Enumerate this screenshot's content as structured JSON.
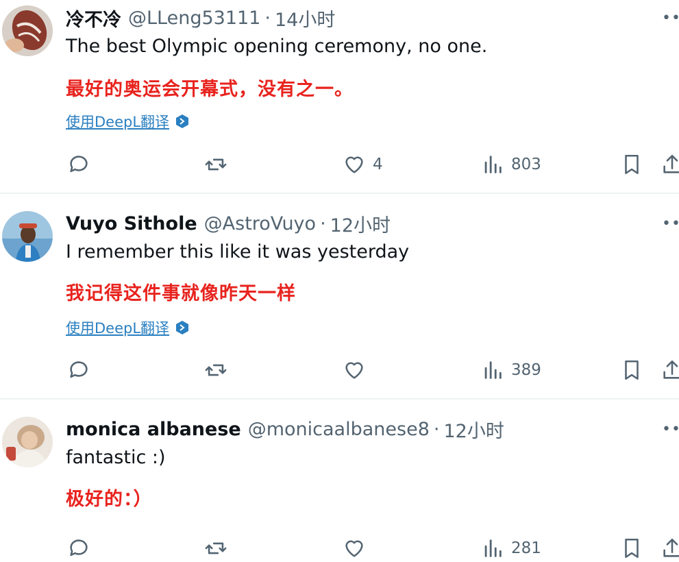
{
  "tweets": [
    {
      "name": "冷不冷",
      "handle": "@LLeng53111",
      "dot": "·",
      "time": "14小时",
      "more": "••",
      "text": "The best Olympic opening ceremony, no one.",
      "translation": "最好的奥运会开幕式，没有之一。",
      "translate_link": "使用DeepL翻译",
      "likes": "4",
      "views": "803"
    },
    {
      "name": "Vuyo Sithole",
      "handle": "@AstroVuyo",
      "dot": "·",
      "time": "12小时",
      "more": "••",
      "text": "I remember this like it was yesterday",
      "translation": "我记得这件事就像昨天一样",
      "translate_link": "使用DeepL翻译",
      "likes": "",
      "views": "389"
    },
    {
      "name": "monica albanese",
      "handle": "@monicaalbanese8",
      "dot": "·",
      "time": "12小时",
      "more": "••",
      "text": "fantastic :)",
      "translation": "极好的：）",
      "translate_link": "",
      "likes": "",
      "views": "281"
    }
  ],
  "colors": {
    "text": "#0f1419",
    "muted": "#536471",
    "translation_red": "#e8231e",
    "link_blue": "#2a7fc0",
    "divider": "#eff3f4"
  },
  "icons": [
    "reply-icon",
    "retweet-icon",
    "like-icon",
    "views-icon",
    "bookmark-icon",
    "share-icon",
    "deepl-icon"
  ]
}
